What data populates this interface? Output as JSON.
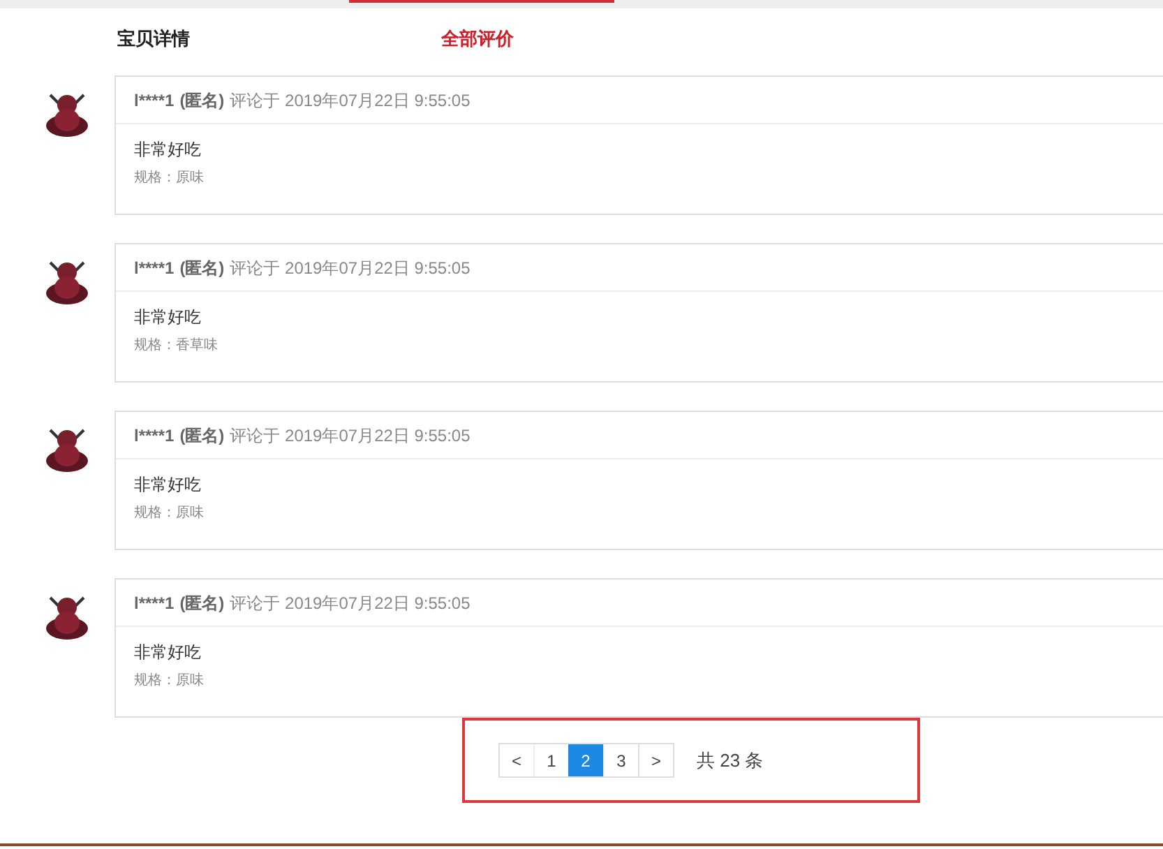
{
  "tabs": [
    {
      "label": "宝贝详情",
      "selected": false
    },
    {
      "label": "全部评价",
      "selected": true
    }
  ],
  "reviews": [
    {
      "user": "l****1",
      "anonymous": "(匿名)",
      "time": "评论于 2019年07月22日 9:55:05",
      "content": "非常好吃",
      "spec": "规格：原味"
    },
    {
      "user": "l****1",
      "anonymous": "(匿名)",
      "time": "评论于 2019年07月22日 9:55:05",
      "content": "非常好吃",
      "spec": "规格：香草味"
    },
    {
      "user": "l****1",
      "anonymous": "(匿名)",
      "time": "评论于 2019年07月22日 9:55:05",
      "content": "非常好吃",
      "spec": "规格：原味"
    },
    {
      "user": "l****1",
      "anonymous": "(匿名)",
      "time": "评论于 2019年07月22日 9:55:05",
      "content": "非常好吃",
      "spec": "规格：原味"
    }
  ],
  "pagination": {
    "prev": "<",
    "pages": [
      {
        "label": "1",
        "selected": false
      },
      {
        "label": "2",
        "selected": true
      },
      {
        "label": "3",
        "selected": false
      }
    ],
    "next": ">",
    "total": "共 23 条"
  }
}
